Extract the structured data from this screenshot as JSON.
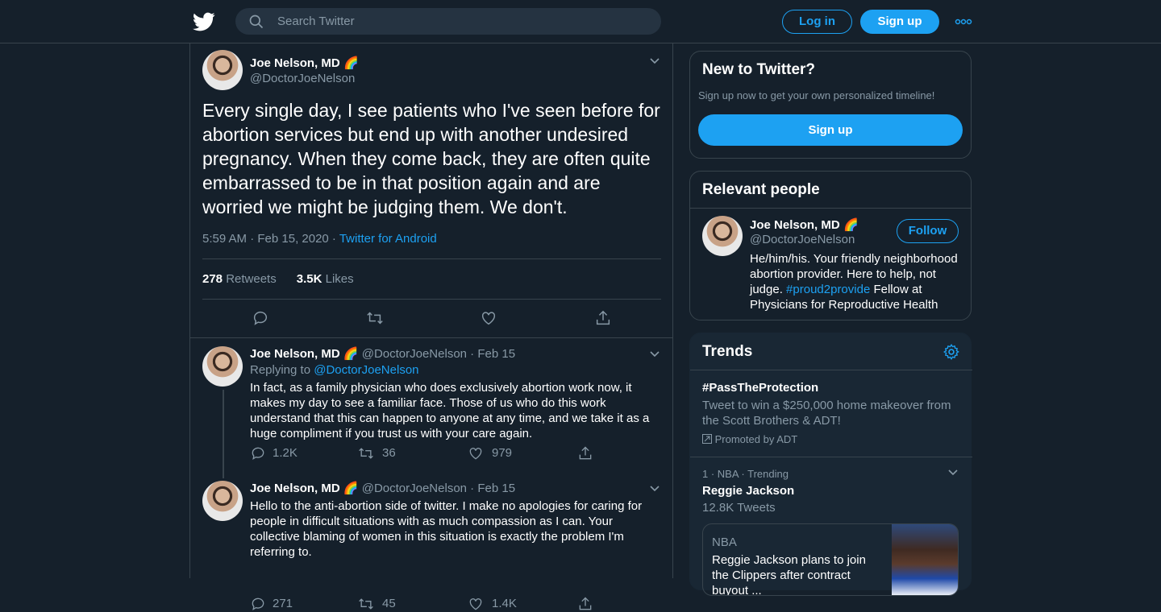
{
  "header": {
    "search_placeholder": "Search Twitter",
    "login_label": "Log in",
    "signup_label": "Sign up"
  },
  "tweet": {
    "display_name": "Joe Nelson, MD",
    "emoji": "🌈",
    "handle": "@DoctorJoeNelson",
    "text": "Every single day, I see patients who I've seen before for abortion services but end up with another undesired pregnancy. When they come back, they are often quite embarrassed to be in that position again and are worried we might be judging them. We don't.",
    "timestamp": "5:59 AM · Feb 15, 2020 · ",
    "source": "Twitter for Android",
    "retweets": "278",
    "retweets_label": " Retweets",
    "likes": "3.5K",
    "likes_label": " Likes"
  },
  "replies": [
    {
      "display_name": "Joe Nelson, MD",
      "emoji": "🌈",
      "handle_date": "@DoctorJoeNelson · Feb 15",
      "replying_prefix": "Replying to ",
      "replying_to": "@DoctorJoeNelson",
      "text": "In fact, as a family physician who does exclusively abortion work now, it makes my day to see a familiar face. Those of us who do this work understand that this can happen to anyone at any time, and we take it as a huge compliment if you trust us with your care again.",
      "replies": "1.2K",
      "retweets": "36",
      "likes": "979"
    },
    {
      "display_name": "Joe Nelson, MD",
      "emoji": "🌈",
      "handle_date": "@DoctorJoeNelson · Feb 15",
      "text": "Hello to the anti-abortion side of twitter. I make no apologies for caring for people in difficult situations with as much compassion as I can. Your collective blaming of women in this situation is exactly the problem I'm referring to.",
      "replies": "271",
      "retweets": "45",
      "likes": "1.4K"
    }
  ],
  "new_to_twitter": {
    "title": "New to Twitter?",
    "subtitle": "Sign up now to get your own personalized timeline!",
    "button": "Sign up"
  },
  "relevant": {
    "title": "Relevant people",
    "display_name": "Joe Nelson, MD",
    "emoji": "🌈",
    "handle": "@DoctorJoeNelson",
    "follow": "Follow",
    "bio_pre": "He/him/his. Your friendly neighborhood abortion provider. Here to help, not judge. ",
    "bio_tag": "#proud2provide",
    "bio_post": " Fellow at Physicians for Reproductive Health"
  },
  "trends": {
    "title": "Trends",
    "promoted": {
      "name": "#PassTheProtection",
      "description": "Tweet to win a $250,000 home makeover from the Scott Brothers & ADT!",
      "promoted_by": "Promoted by ADT"
    },
    "item": {
      "meta": "1 · NBA · Trending",
      "name": "Reggie Jackson",
      "count": "12.8K Tweets"
    },
    "card": {
      "source": "NBA",
      "headline": "Reggie Jackson plans to join the Clippers after contract buyout ..."
    }
  }
}
